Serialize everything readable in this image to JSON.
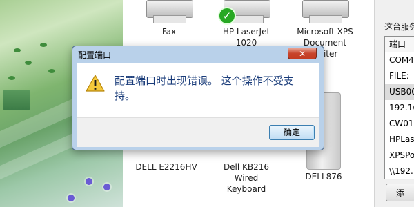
{
  "devices": {
    "top": [
      {
        "label": "Fax",
        "icon": "fax-printer-icon"
      },
      {
        "label": "HP LaserJet\n1020",
        "icon": "printer-icon",
        "default_badge_icon": "checkmark-icon"
      },
      {
        "label": "Microsoft XPS\nDocument\nWriter",
        "icon": "printer-icon"
      }
    ],
    "bottom": [
      {
        "label": "DELL E2216HV",
        "icon": "monitor-icon"
      },
      {
        "label": "Dell KB216\nWired\nKeyboard",
        "icon": "keyboard-icon"
      },
      {
        "label": "DELL876",
        "icon": "hard-drive-icon"
      }
    ]
  },
  "side_pane": {
    "title": "这台服务",
    "list_header": "端口",
    "ports": [
      "COM4",
      "FILE:",
      "USB00",
      "192.16",
      "CW01",
      "HPLas",
      "XPSPo",
      "\\\\192."
    ],
    "selected_index": 2,
    "button_label": "添"
  },
  "dialog": {
    "title": "配置端口",
    "close_label": "✕",
    "message": "配置端口时出现错误。 这个操作不受支持。",
    "ok_label": "确定",
    "icon": "warning-icon"
  },
  "colors": {
    "dialog_frame": "#b9d1ea",
    "message_text": "#1a3c7a",
    "close_button": "#c7432b",
    "default_badge": "#27a823"
  }
}
